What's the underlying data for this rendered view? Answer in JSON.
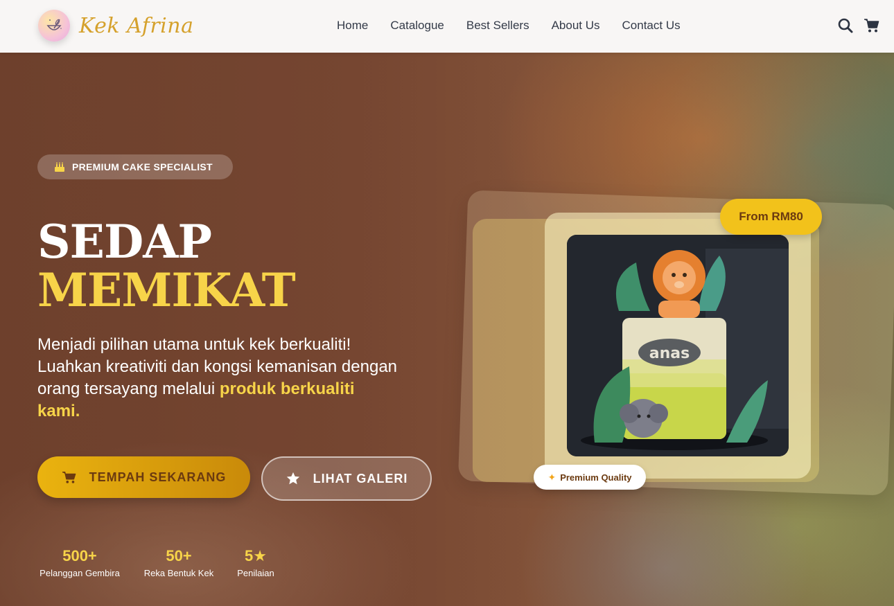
{
  "brand": {
    "name": "Kek Afrina"
  },
  "nav": {
    "items": [
      "Home",
      "Catalogue",
      "Best Sellers",
      "About Us",
      "Contact Us"
    ]
  },
  "header_icons": [
    "search-icon",
    "cart-icon"
  ],
  "hero": {
    "badge": "PREMIUM CAKE SPECIALIST",
    "title_line1": "SEDAP",
    "title_line2": "MEMIKAT",
    "description": "Menjadi pilihan utama untuk kek berkualiti! Luahkan kreativiti dan kongsi kemanisan dengan orang tersayang melalui",
    "description_highlight": "produk berkualiti kami.",
    "cta_primary": "TEMPAH SEKARANG",
    "cta_secondary": "LIHAT GALERI"
  },
  "stats": [
    {
      "value": "500+",
      "label": "Pelanggan Gembira"
    },
    {
      "value": "50+",
      "label": "Reka Bentuk Kek"
    },
    {
      "value": "5★",
      "label": "Penilaian"
    }
  ],
  "card": {
    "price_badge": "From RM80",
    "quality_badge": "Premium Quality",
    "cake_name_text": "anas"
  },
  "colors": {
    "accent_gold": "#f7d449",
    "button_gold": "#eab30f",
    "brand_text": "#d5a12c",
    "nav_text": "#333a48"
  }
}
